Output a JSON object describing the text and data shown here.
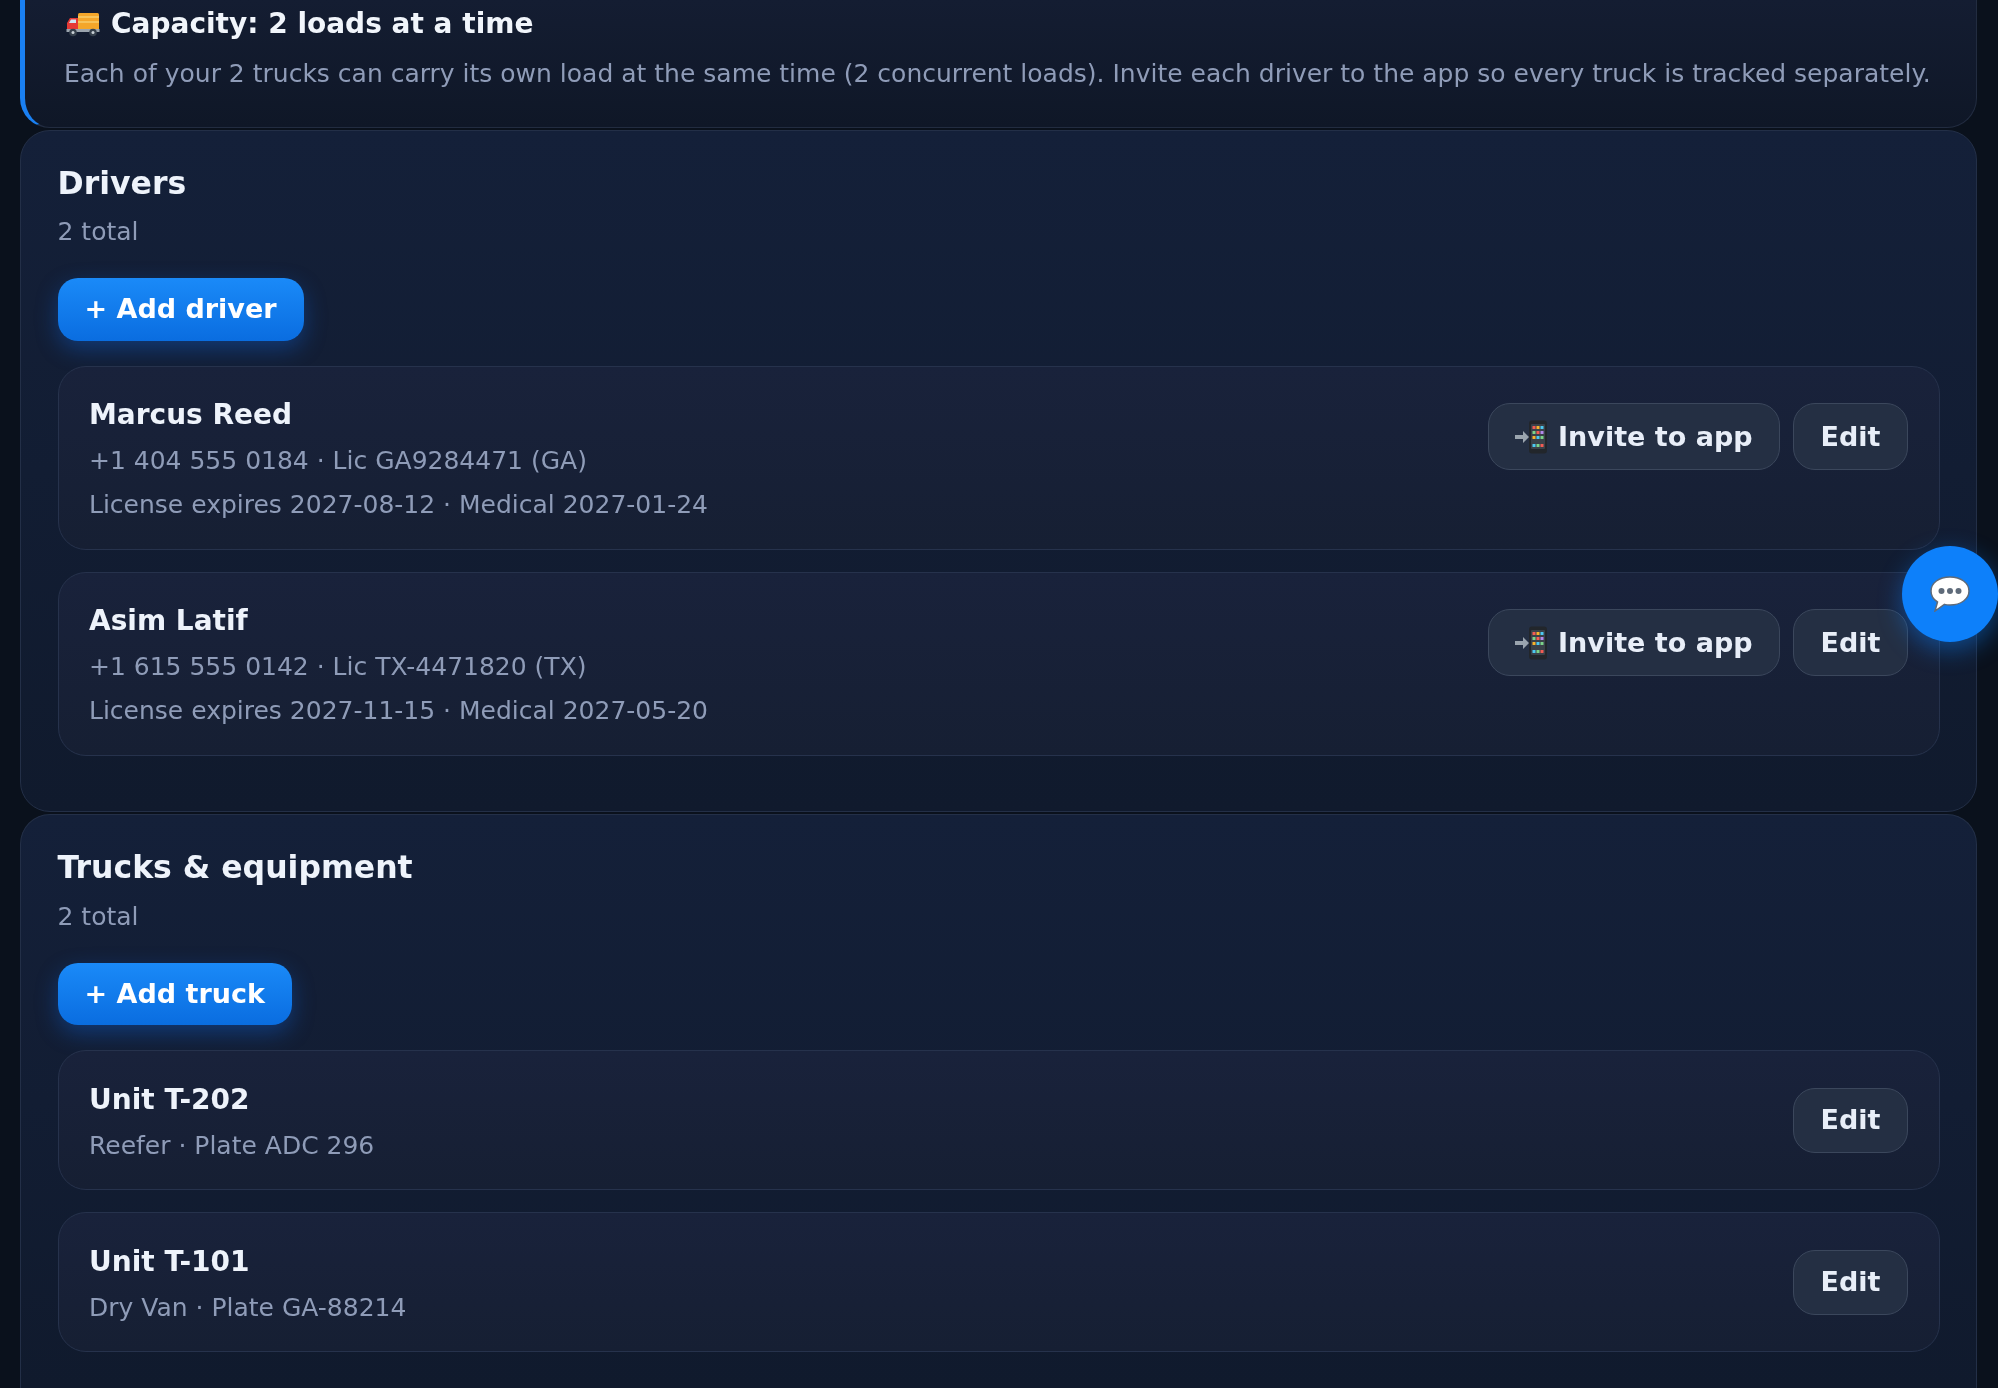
{
  "capacity_banner": {
    "title": "Capacity: 2 loads at a time",
    "description": "Each of your 2 trucks can carry its own load at the same time (2 concurrent loads). Invite each driver to the app so every truck is tracked separately."
  },
  "sections": [
    {
      "title": "Drivers",
      "count": "2 total",
      "add_button": "+ Add driver",
      "items": [
        {
          "name": "Marcus Reed",
          "details": [
            "+1 404 555 0184 · Lic GA9284471 (GA)",
            "License expires 2027-08-12 · Medical 2027-01-24"
          ],
          "actions": [
            {
              "kind": "invite",
              "label": "Invite to app"
            },
            {
              "kind": "edit",
              "label": "Edit"
            }
          ]
        },
        {
          "name": "Asim Latif",
          "details": [
            "+1 615 555 0142 · Lic TX-4471820 (TX)",
            "License expires 2027-11-15 · Medical 2027-05-20"
          ],
          "actions": [
            {
              "kind": "invite",
              "label": "Invite to app"
            },
            {
              "kind": "edit",
              "label": "Edit"
            }
          ]
        }
      ]
    },
    {
      "title": "Trucks & equipment",
      "count": "2 total",
      "add_button": "+ Add truck",
      "items": [
        {
          "name": "Unit T-202",
          "details": [
            "Reefer · Plate ADC 296"
          ],
          "actions": [
            {
              "kind": "edit",
              "label": "Edit"
            }
          ]
        },
        {
          "name": "Unit T-101",
          "details": [
            "Dry Van · Plate GA-88214"
          ],
          "actions": [
            {
              "kind": "edit",
              "label": "Edit"
            }
          ]
        }
      ]
    }
  ]
}
